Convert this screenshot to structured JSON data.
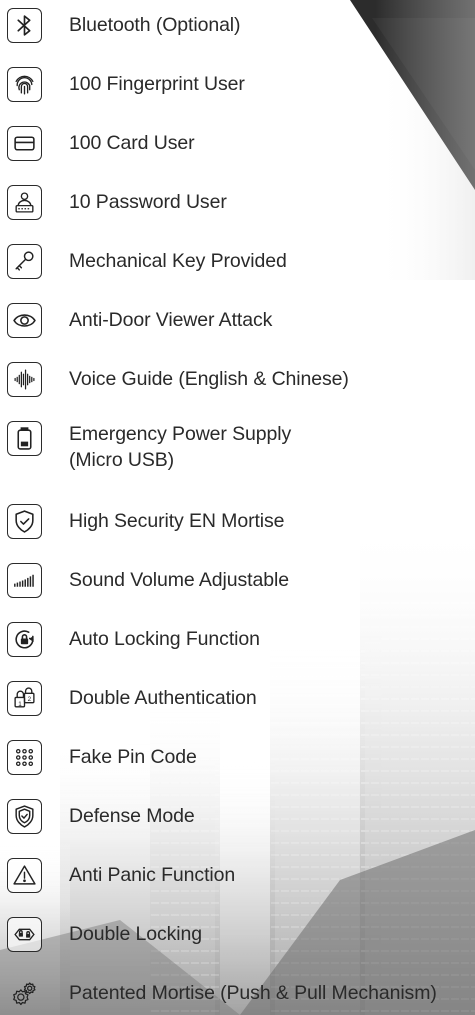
{
  "features": [
    {
      "label": "Bluetooth (Optional)",
      "icon": "bluetooth-icon"
    },
    {
      "label": "100 Fingerprint User",
      "icon": "fingerprint-icon"
    },
    {
      "label": "100 Card User",
      "icon": "card-icon"
    },
    {
      "label": "10 Password User",
      "icon": "password-user-icon"
    },
    {
      "label": "Mechanical Key Provided",
      "icon": "key-icon"
    },
    {
      "label": "Anti-Door Viewer Attack",
      "icon": "eye-icon"
    },
    {
      "label": "Voice Guide (English & Chinese)",
      "icon": "voice-waveform-icon"
    },
    {
      "label": "Emergency Power Supply",
      "label_line2": "(Micro USB)",
      "icon": "battery-icon"
    },
    {
      "label": "High Security EN Mortise",
      "icon": "shield-check-icon"
    },
    {
      "label": "Sound Volume Adjustable",
      "icon": "volume-bars-icon"
    },
    {
      "label": "Auto Locking Function",
      "icon": "auto-lock-icon"
    },
    {
      "label": "Double Authentication",
      "icon": "double-auth-icon"
    },
    {
      "label": "Fake Pin Code",
      "icon": "keypad-icon"
    },
    {
      "label": "Defense Mode",
      "icon": "defense-shield-icon"
    },
    {
      "label": "Anti Panic Function",
      "icon": "warning-icon"
    },
    {
      "label": "Double Locking",
      "icon": "double-lock-icon"
    },
    {
      "label": "Patented Mortise (Push & Pull Mechanism)",
      "icon": "gears-icon"
    }
  ]
}
